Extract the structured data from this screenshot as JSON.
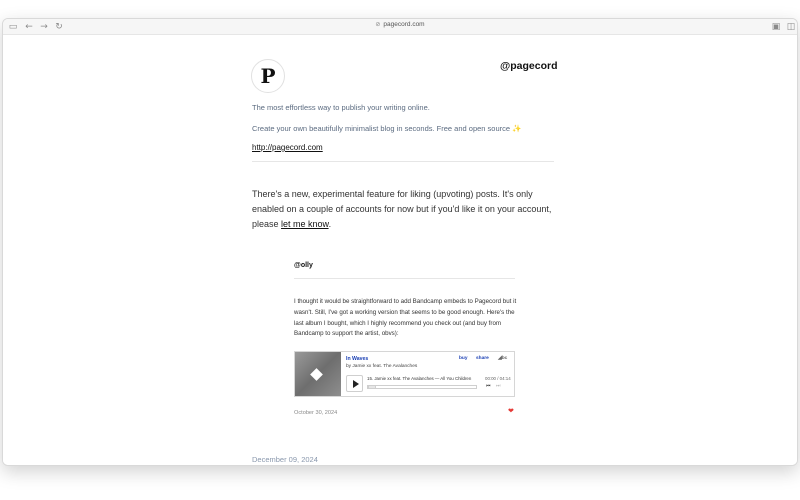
{
  "browser": {
    "url": "pagecord.com",
    "icons": [
      "sidebar-icon",
      "back-arrow-icon",
      "forward-arrow-icon",
      "reload-icon",
      "lock-icon",
      "reader-icon",
      "split-view-icon"
    ]
  },
  "profile": {
    "avatar_letter": "P",
    "handle": "@pagecord",
    "tagline_1": "The most effortless way to publish your writing online.",
    "tagline_2": "Create your own beautifully minimalist blog in seconds. Free and open source ✨",
    "site_url": "http://pagecord.com"
  },
  "post": {
    "intro_before_link": "There's a new, experimental feature for liking (upvoting) posts. It's only enabled on a couple of accounts for now but if you'd like it on your account, please ",
    "link_text": "let me know",
    "intro_after_link": ".",
    "embed": {
      "author": "@olly",
      "body": "I thought it would be straightforward to add Bandcamp embeds to Pagecord but it wasn't. Still, I've got a working version that seems to be good enough. Here's the last album I bought, which I highly recommend you check out (and buy from Bandcamp to support the artist, obvs):",
      "bandcamp": {
        "album": "In Waves",
        "artist": "by Jamie xx feat. The Avalanches",
        "buy": "buy",
        "share": "share",
        "logo": "◢bc",
        "track": "15. Jamie xx feat. The Avalanches — All You Children",
        "time": "00:00 / 04:14",
        "progress": 0
      },
      "date": "October 30, 2024",
      "liked": true
    },
    "next_date": "December 09, 2024"
  }
}
